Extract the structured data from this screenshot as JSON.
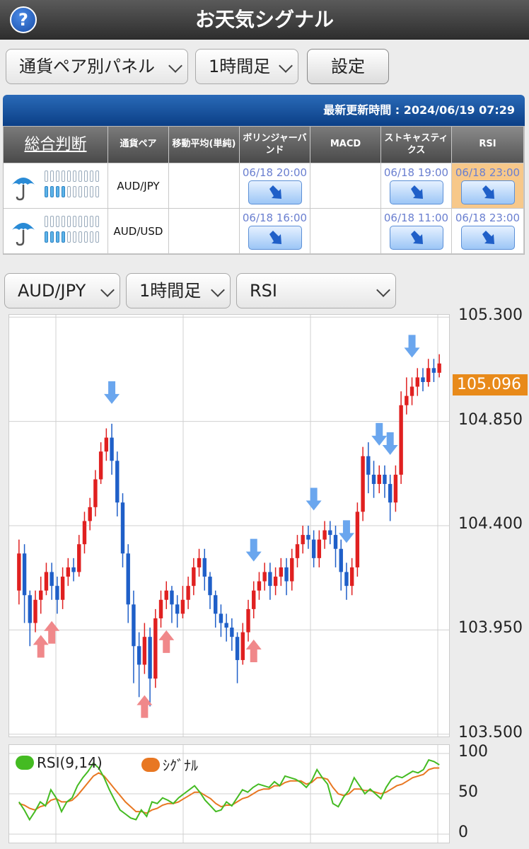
{
  "header": {
    "title": "お天気シグナル",
    "help_icon": "?"
  },
  "toolbar": {
    "panel_select": "通貨ペア別パネル",
    "timeframe_select": "1時間足",
    "settings_button": "設定"
  },
  "panel": {
    "updated": "最新更新時間 : 2024/06/19 07:29",
    "columns": [
      "総合判断",
      "通貨ペア",
      "移動平均(単純)",
      "ボリンジャーバンド",
      "MACD",
      "ストキャスティクス",
      "RSI"
    ],
    "rows": [
      {
        "weather_icon": "umbrella-icon",
        "meter_on": 4,
        "meter_total": 10,
        "pair": "AUD/JPY",
        "ma": "",
        "bollinger": "06/18 20:00",
        "macd": "",
        "stoch": "06/18 19:00",
        "rsi": "06/18 23:00",
        "rsi_highlight": true
      },
      {
        "weather_icon": "umbrella-icon",
        "meter_on": 4,
        "meter_total": 10,
        "pair": "AUD/USD",
        "ma": "",
        "bollinger": "06/18 16:00",
        "macd": "",
        "stoch": "06/18 11:00",
        "rsi": "06/18 23:00",
        "rsi_highlight": false
      }
    ]
  },
  "chart_controls": {
    "pair_select": "AUD/JPY",
    "timeframe_select": "1時間足",
    "indicator_select": "RSI"
  },
  "chart_data": {
    "type": "candlestick",
    "y_ticks": [
      "105.300",
      "104.850",
      "104.400",
      "103.950",
      "103.500"
    ],
    "ylim": [
      103.49,
      105.31
    ],
    "last_price": "105.096",
    "candles": [
      [
        104.12,
        104.28,
        104.34,
        104.06
      ],
      [
        104.28,
        104.1,
        104.32,
        103.98
      ],
      [
        104.1,
        103.98,
        104.12,
        103.88
      ],
      [
        103.98,
        104.08,
        104.12,
        103.94
      ],
      [
        104.08,
        104.12,
        104.18,
        104.02
      ],
      [
        104.12,
        104.2,
        104.24,
        104.1
      ],
      [
        104.2,
        104.14,
        104.24,
        104.08
      ],
      [
        104.14,
        104.08,
        104.18,
        104.02
      ],
      [
        104.08,
        104.18,
        104.22,
        104.04
      ],
      [
        104.18,
        104.22,
        104.26,
        104.14
      ],
      [
        104.22,
        104.2,
        104.26,
        104.16
      ],
      [
        104.2,
        104.32,
        104.36,
        104.18
      ],
      [
        104.32,
        104.42,
        104.46,
        104.28
      ],
      [
        104.42,
        104.48,
        104.52,
        104.38
      ],
      [
        104.48,
        104.6,
        104.64,
        104.44
      ],
      [
        104.6,
        104.72,
        104.76,
        104.58
      ],
      [
        104.72,
        104.78,
        104.82,
        104.68
      ],
      [
        104.78,
        104.68,
        104.84,
        104.62
      ],
      [
        104.68,
        104.5,
        104.72,
        104.44
      ],
      [
        104.5,
        104.28,
        104.54,
        104.22
      ],
      [
        104.28,
        104.06,
        104.32,
        103.98
      ],
      [
        104.06,
        103.88,
        104.12,
        103.72
      ],
      [
        103.88,
        103.8,
        103.94,
        103.66
      ],
      [
        103.8,
        103.92,
        103.98,
        103.76
      ],
      [
        103.92,
        103.74,
        103.96,
        103.62
      ],
      [
        103.74,
        104.0,
        104.04,
        103.7
      ],
      [
        104.0,
        104.08,
        104.12,
        103.96
      ],
      [
        104.08,
        104.12,
        104.16,
        104.04
      ],
      [
        104.12,
        104.06,
        104.14,
        103.98
      ],
      [
        104.06,
        104.02,
        104.1,
        103.96
      ],
      [
        104.02,
        104.08,
        104.14,
        104.0
      ],
      [
        104.08,
        104.14,
        104.18,
        104.04
      ],
      [
        104.14,
        104.22,
        104.26,
        104.1
      ],
      [
        104.22,
        104.26,
        104.3,
        104.18
      ],
      [
        104.26,
        104.18,
        104.3,
        104.12
      ],
      [
        104.18,
        104.1,
        104.2,
        104.04
      ],
      [
        104.1,
        104.02,
        104.12,
        103.96
      ],
      [
        104.02,
        103.98,
        104.06,
        103.92
      ],
      [
        103.98,
        103.96,
        104.02,
        103.9
      ],
      [
        103.96,
        103.92,
        104.0,
        103.86
      ],
      [
        103.92,
        103.82,
        103.94,
        103.72
      ],
      [
        103.82,
        103.94,
        103.98,
        103.8
      ],
      [
        103.94,
        104.04,
        104.08,
        103.9
      ],
      [
        104.04,
        104.12,
        104.16,
        104.0
      ],
      [
        104.12,
        104.16,
        104.2,
        104.08
      ],
      [
        104.16,
        104.2,
        104.24,
        104.12
      ],
      [
        104.2,
        104.14,
        104.24,
        104.08
      ],
      [
        104.14,
        104.18,
        104.22,
        104.1
      ],
      [
        104.18,
        104.22,
        104.26,
        104.14
      ],
      [
        104.22,
        104.16,
        104.26,
        104.1
      ],
      [
        104.16,
        104.26,
        104.3,
        104.12
      ],
      [
        104.26,
        104.32,
        104.36,
        104.22
      ],
      [
        104.32,
        104.36,
        104.4,
        104.28
      ],
      [
        104.36,
        104.34,
        104.4,
        104.3
      ],
      [
        104.34,
        104.26,
        104.38,
        104.22
      ],
      [
        104.26,
        104.34,
        104.38,
        104.22
      ],
      [
        104.34,
        104.38,
        104.42,
        104.3
      ],
      [
        104.38,
        104.36,
        104.42,
        104.32
      ],
      [
        104.36,
        104.3,
        104.4,
        104.22
      ],
      [
        104.3,
        104.2,
        104.34,
        104.12
      ],
      [
        104.2,
        104.14,
        104.24,
        104.08
      ],
      [
        104.14,
        104.22,
        104.26,
        104.1
      ],
      [
        104.22,
        104.46,
        104.5,
        104.18
      ],
      [
        104.46,
        104.7,
        104.74,
        104.42
      ],
      [
        104.7,
        104.62,
        104.76,
        104.54
      ],
      [
        104.62,
        104.58,
        104.68,
        104.52
      ],
      [
        104.58,
        104.62,
        104.66,
        104.54
      ],
      [
        104.62,
        104.58,
        104.66,
        104.52
      ],
      [
        104.58,
        104.5,
        104.62,
        104.42
      ],
      [
        104.5,
        104.62,
        104.66,
        104.46
      ],
      [
        104.62,
        104.92,
        104.98,
        104.58
      ],
      [
        104.92,
        104.96,
        105.04,
        104.88
      ],
      [
        104.96,
        105.0,
        105.04,
        104.92
      ],
      [
        105.0,
        105.04,
        105.08,
        104.96
      ],
      [
        105.04,
        105.02,
        105.08,
        104.98
      ],
      [
        105.02,
        105.08,
        105.12,
        105.0
      ],
      [
        105.08,
        105.06,
        105.12,
        105.02
      ],
      [
        105.06,
        105.1,
        105.14,
        105.04
      ]
    ],
    "signals_down": [
      17,
      43,
      54,
      60,
      66,
      68,
      72
    ],
    "signals_up": [
      4,
      6,
      23,
      27,
      43
    ],
    "rsi_legend": [
      "RSI(9,14)",
      "ｼｸﾞﾅﾙ"
    ],
    "rsi_ticks": [
      "100",
      "50",
      "0"
    ],
    "rsi_series": [
      40,
      30,
      18,
      28,
      40,
      35,
      55,
      45,
      28,
      40,
      45,
      60,
      70,
      78,
      88,
      82,
      70,
      55,
      42,
      30,
      25,
      20,
      18,
      30,
      22,
      40,
      38,
      45,
      42,
      38,
      45,
      50,
      55,
      60,
      52,
      42,
      35,
      28,
      30,
      40,
      35,
      45,
      55,
      52,
      58,
      62,
      60,
      58,
      65,
      60,
      72,
      70,
      68,
      64,
      58,
      66,
      80,
      70,
      62,
      38,
      34,
      46,
      54,
      70,
      60,
      50,
      56,
      50,
      44,
      58,
      68,
      72,
      70,
      74,
      78,
      76,
      80,
      92,
      90,
      86
    ],
    "signal_series": [
      38,
      36,
      32,
      30,
      34,
      36,
      42,
      44,
      40,
      40,
      42,
      48,
      56,
      64,
      72,
      76,
      72,
      64,
      56,
      48,
      40,
      34,
      28,
      28,
      26,
      30,
      32,
      36,
      38,
      38,
      40,
      44,
      48,
      52,
      52,
      48,
      44,
      38,
      34,
      36,
      36,
      40,
      44,
      46,
      50,
      54,
      56,
      56,
      60,
      60,
      64,
      66,
      66,
      66,
      62,
      64,
      70,
      70,
      68,
      58,
      50,
      48,
      50,
      56,
      56,
      54,
      54,
      52,
      50,
      52,
      56,
      60,
      62,
      66,
      70,
      72,
      74,
      80,
      82,
      82
    ]
  },
  "colors": {
    "up": "#e02020",
    "down": "#1f5fc8",
    "rsi": "#44bb22",
    "signal": "#e87722",
    "arrow_down": "#6aa6ee",
    "arrow_up": "#f0888a"
  }
}
